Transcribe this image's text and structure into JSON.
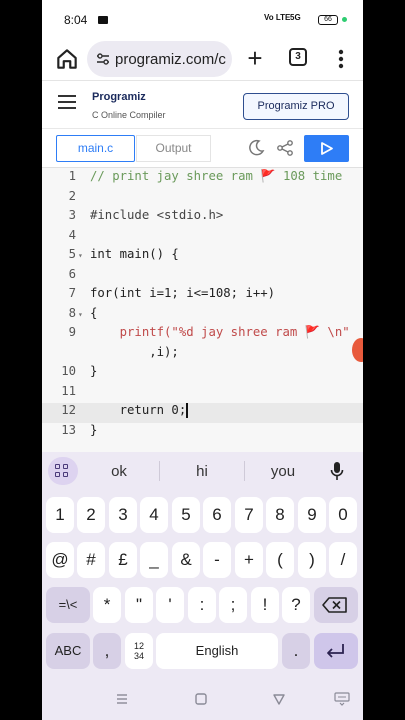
{
  "status_bar": {
    "time": "8:04",
    "signal_1": "Vo LTE",
    "signal_2": "5G",
    "battery": "66"
  },
  "browser": {
    "url": "programiz.com/c",
    "tab_count": "3"
  },
  "site": {
    "logo_text": "Programiz",
    "subtitle": "C Online Compiler",
    "pro_button": "Programiz PRO"
  },
  "editor_tabs": {
    "main_tab": "main.c",
    "output_tab": "Output"
  },
  "code_lines": [
    {
      "num": "1",
      "text": "// print jay shree ram 🚩 108 time"
    },
    {
      "num": "2",
      "text": ""
    },
    {
      "num": "3",
      "text": "#include <stdio.h>"
    },
    {
      "num": "4",
      "text": ""
    },
    {
      "num": "5",
      "text": "int main() {"
    },
    {
      "num": "6",
      "text": ""
    },
    {
      "num": "7",
      "text": "for(int i=1; i<=108; i++)"
    },
    {
      "num": "8",
      "text": "{"
    },
    {
      "num": "9",
      "text": "    printf(\"%d jay shree ram 🚩 \\n\""
    },
    {
      "num": "",
      "text": "        ,i);"
    },
    {
      "num": "10",
      "text": "}"
    },
    {
      "num": "11",
      "text": ""
    },
    {
      "num": "12",
      "text": "    return 0;"
    },
    {
      "num": "13",
      "text": "}"
    }
  ],
  "keyboard": {
    "suggestions": [
      "ok",
      "hi",
      "you"
    ],
    "row_numbers": [
      "1",
      "2",
      "3",
      "4",
      "5",
      "6",
      "7",
      "8",
      "9",
      "0"
    ],
    "row_symbols_1": [
      "@",
      "#",
      "£",
      "_",
      "&",
      "-",
      "+",
      "(",
      ")",
      "/"
    ],
    "row_symbols_2": [
      "*",
      "\"",
      "'",
      ":",
      ";",
      "!",
      "?"
    ],
    "shift_key": "=\\<",
    "abc_key": "ABC",
    "comma_key": ",",
    "numpad_key": "12\n34",
    "space_key": "English",
    "period_key": "."
  }
}
